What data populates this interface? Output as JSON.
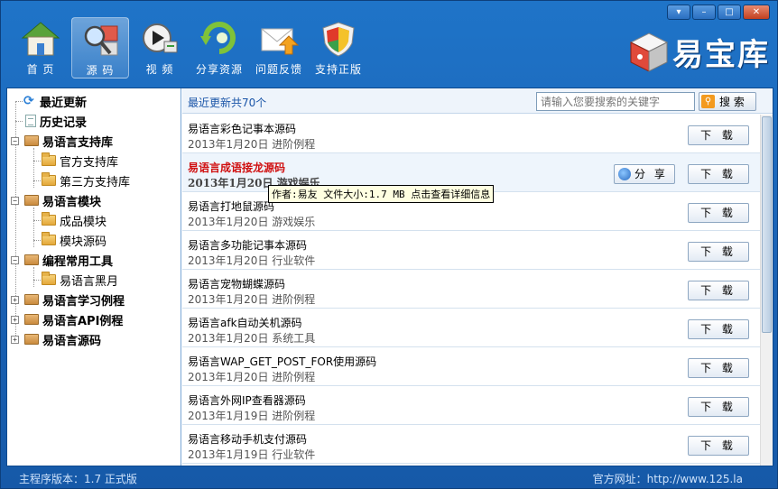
{
  "window": {
    "controls": {
      "dropdown": "▾",
      "minimize": "–",
      "maximize": "□",
      "close": "✕"
    }
  },
  "toolbar": {
    "items": [
      {
        "label": "首 页",
        "icon": "home-icon"
      },
      {
        "label": "源 码",
        "icon": "source-code-icon",
        "active": true
      },
      {
        "label": "视 频",
        "icon": "video-icon"
      },
      {
        "label": "分享资源",
        "icon": "share-resource-icon"
      },
      {
        "label": "问题反馈",
        "icon": "feedback-mail-icon"
      },
      {
        "label": "支持正版",
        "icon": "shield-icon"
      }
    ]
  },
  "logo": {
    "text": "易宝库"
  },
  "tree": {
    "items": [
      {
        "label": "最近更新"
      },
      {
        "label": "历史记录"
      },
      {
        "label": "易语言支持库"
      },
      {
        "label": "官方支持库"
      },
      {
        "label": "第三方支持库"
      },
      {
        "label": "易语言模块"
      },
      {
        "label": "成品模块"
      },
      {
        "label": "模块源码"
      },
      {
        "label": "编程常用工具"
      },
      {
        "label": "易语言黑月"
      },
      {
        "label": "易语言学习例程"
      },
      {
        "label": "易语言API例程"
      },
      {
        "label": "易语言源码"
      }
    ]
  },
  "list": {
    "count_label": "最近更新共70个",
    "search_placeholder": "请输入您要搜索的关键字",
    "search_button": "搜 索",
    "download_label": "下 载",
    "share_label": "分 享",
    "rows": [
      {
        "title": "易语言彩色记事本源码",
        "date": "2013年1月20日",
        "category": "进阶例程"
      },
      {
        "title": "易语言成语接龙源码",
        "date": "2013年1月20日",
        "category": "游戏娱乐",
        "highlighted": true
      },
      {
        "title": "易语言打地鼠源码",
        "date": "2013年1月20日",
        "category": "游戏娱乐"
      },
      {
        "title": "易语言多功能记事本源码",
        "date": "2013年1月20日",
        "category": "行业软件"
      },
      {
        "title": "易语言宠物蝴蝶源码",
        "date": "2013年1月20日",
        "category": "进阶例程"
      },
      {
        "title": "易语言afk自动关机源码",
        "date": "2013年1月20日",
        "category": "系统工具"
      },
      {
        "title": "易语言WAP_GET_POST_FOR使用源码",
        "date": "2013年1月20日",
        "category": "进阶例程"
      },
      {
        "title": "易语言外网IP查看器源码",
        "date": "2013年1月19日",
        "category": "进阶例程"
      },
      {
        "title": "易语言移动手机支付源码",
        "date": "2013年1月19日",
        "category": "行业软件"
      }
    ],
    "tooltip": "作者:易友 文件大小:1.7 MB 点击查看详细信息"
  },
  "status": {
    "version": "主程序版本：1.7 正式版",
    "website": "官方网址：http://www.125.la"
  },
  "colors": {
    "accent": "#1a63b6",
    "highlight_title": "#d01010"
  }
}
